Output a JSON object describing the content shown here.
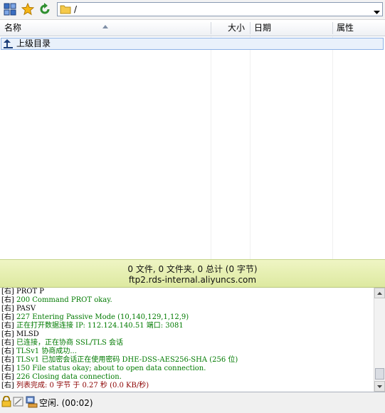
{
  "toolbar": {
    "path": "/"
  },
  "columns": {
    "name": "名称",
    "size": "大小",
    "date": "日期",
    "attributes": "属性"
  },
  "file_list": {
    "parent_dir_label": "上级目录"
  },
  "summary": {
    "counts": "0 文件, 0 文件夹, 0 总计 (0 字节)",
    "server": "ftp2.rds-internal.aliyuncs.com"
  },
  "log": [
    {
      "tag": "[右]",
      "text": "PROT P",
      "color": "black"
    },
    {
      "tag": "[右]",
      "text": "200 Command PROT okay.",
      "color": "green"
    },
    {
      "tag": "[右]",
      "text": "PASV",
      "color": "black"
    },
    {
      "tag": "[右]",
      "text": "227 Entering Passive Mode (10,140,129,1,12,9)",
      "color": "green"
    },
    {
      "tag": "[右]",
      "text": "正在打开数据连接 IP: 112.124.140.51 端口: 3081",
      "color": "green"
    },
    {
      "tag": "[右]",
      "text": "MLSD",
      "color": "black"
    },
    {
      "tag": "[右]",
      "text": "已连接，正在协商 SSL/TLS 会话",
      "color": "green"
    },
    {
      "tag": "[右]",
      "text": "TLSv1 协商成功...",
      "color": "green"
    },
    {
      "tag": "[右]",
      "text": "TLSv1 已加密会话正在使用密码 DHE-DSS-AES256-SHA (256 位)",
      "color": "green"
    },
    {
      "tag": "[右]",
      "text": "150 File status okay; about to open data connection.",
      "color": "green"
    },
    {
      "tag": "[右]",
      "text": "226 Closing data connection.",
      "color": "green"
    },
    {
      "tag": "[右]",
      "text": "列表完成: 0 字节 于 0.27 秒 (0.0 KB/秒)",
      "color": "red"
    }
  ],
  "statusbar": {
    "text": "空闲. (00:02)"
  }
}
